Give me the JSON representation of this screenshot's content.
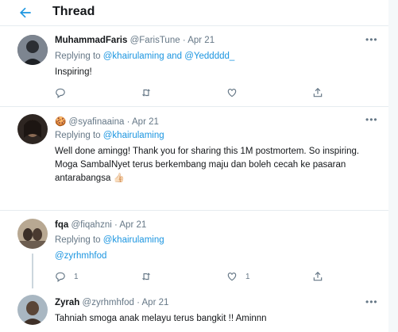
{
  "header": {
    "title": "Thread"
  },
  "tweets": [
    {
      "display_name": "MuhammadFaris",
      "handle": "@FarisTune",
      "date": "Apr 21",
      "replying_prefix": "Replying to",
      "mention_1": "@khairulaming",
      "mention_and": "and",
      "mention_2": "@Yeddddd_",
      "text": "Inspiring!",
      "reply_count": "",
      "avatar_color": "#3b3f47"
    },
    {
      "display_name_emoji": "🍪",
      "handle": "@syafinaaina",
      "date": "Apr 21",
      "replying_prefix": "Replying to",
      "mention_1": "@khairulaming",
      "text_line_1": "Well done amingg! Thank you for sharing this 1M postmortem. So inspiring.",
      "text_line_2": "Moga SambalNyet terus berkembang maju dan boleh cecah ke pasaran",
      "text_line_3": "antarabangsa",
      "text_emoji": "👍🏻",
      "avatar_color": "#4a3c33"
    },
    {
      "display_name": "fqa",
      "handle": "@fiqahzni",
      "date": "Apr 21",
      "replying_prefix": "Replying to",
      "mention_1": "@khairulaming",
      "text_mention": "@zyrhmhfod",
      "reply_count": "1",
      "like_count": "1",
      "avatar_color": "#7a6a5a"
    },
    {
      "display_name": "Zyrah",
      "handle": "@zyrhmhfod",
      "date": "Apr 21",
      "text": "Tahniah smoga anak melayu terus bangkit !! Aminnn",
      "avatar_color": "#6b5a4e"
    }
  ],
  "separator": "·",
  "more_glyph": "•••",
  "icons": [
    "back-arrow-icon",
    "reply-icon",
    "retweet-icon",
    "like-icon",
    "share-icon",
    "more-icon"
  ],
  "colors": {
    "accent": "#1b95e0",
    "muted": "#657786",
    "text": "#14171a",
    "border": "#e6ecf0"
  }
}
